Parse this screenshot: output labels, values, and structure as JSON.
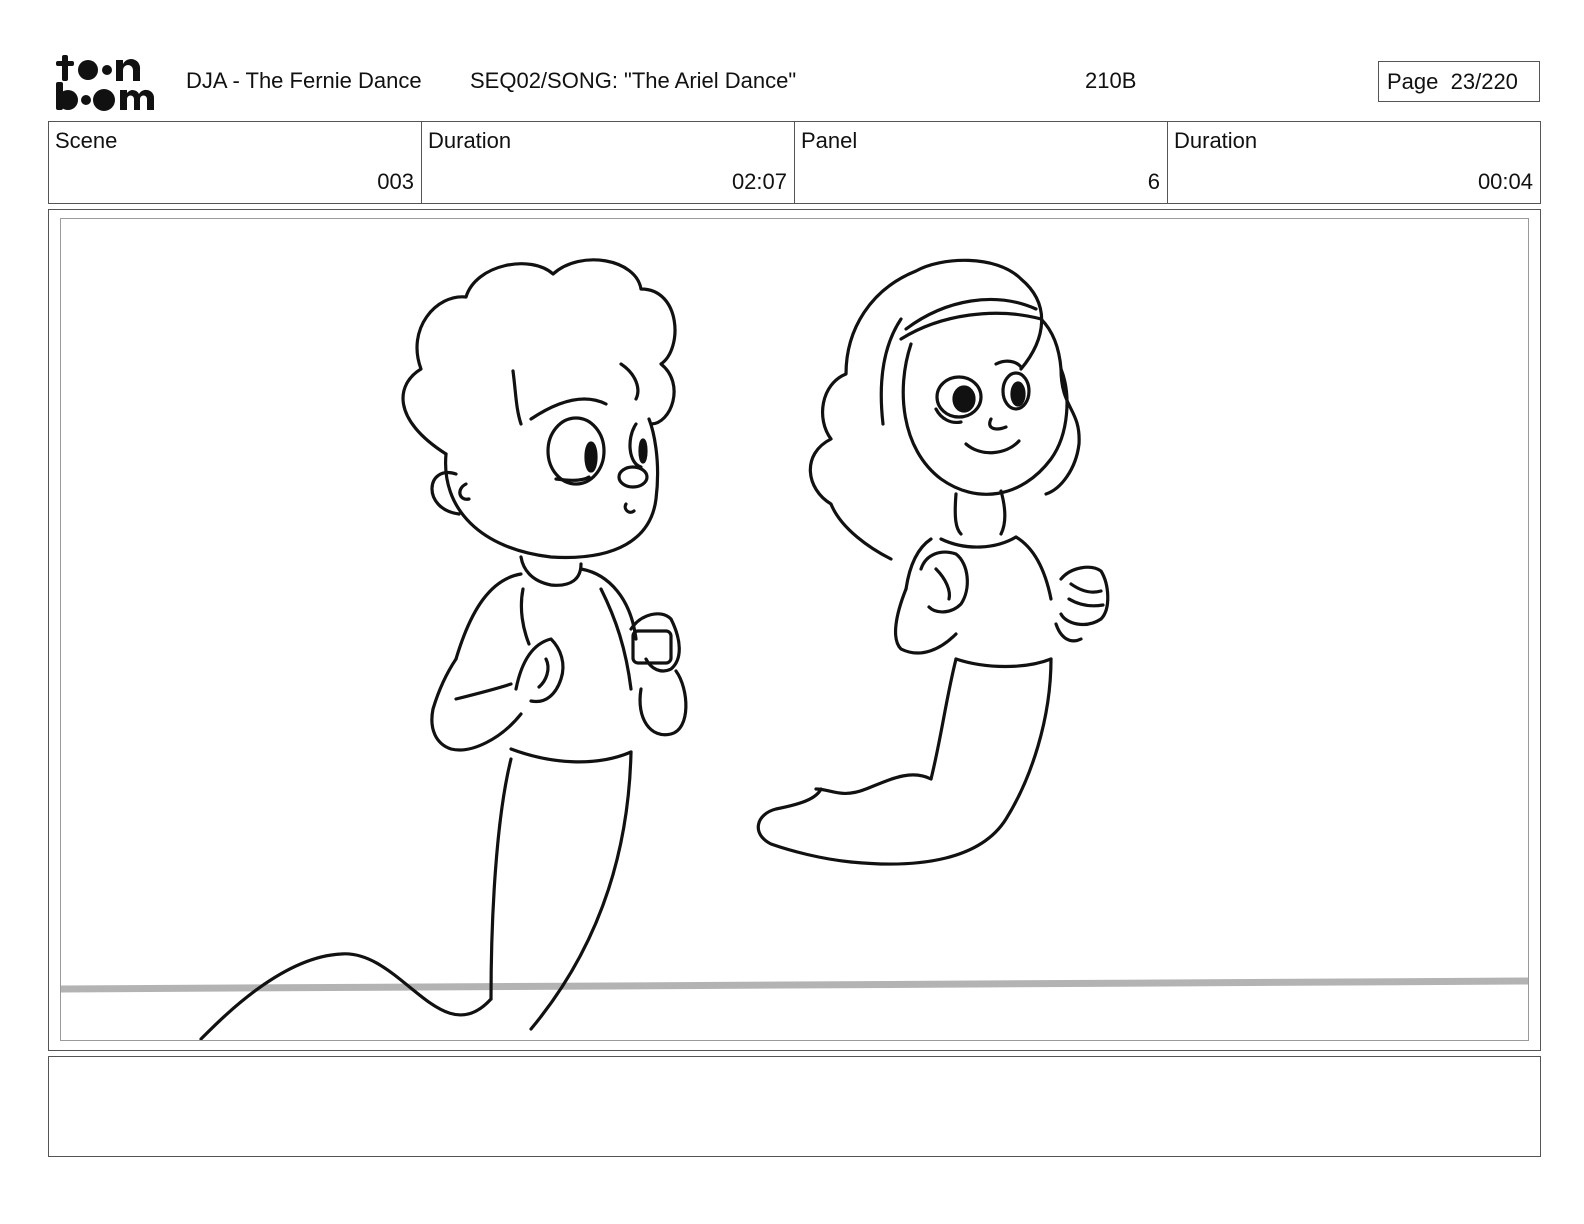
{
  "header": {
    "logo_text_top": "toon",
    "logo_text_bottom": "boom",
    "project_title": "DJA - The Fernie Dance",
    "sequence": "SEQ02/SONG: \"The Ariel Dance\"",
    "shot_code": "210B",
    "page_label": "Page",
    "page_value": "23/220"
  },
  "info": {
    "scene_label": "Scene",
    "scene_value": "003",
    "scene_duration_label": "Duration",
    "scene_duration_value": "02:07",
    "panel_label": "Panel",
    "panel_value": "6",
    "panel_duration_label": "Duration",
    "panel_duration_value": "00:04"
  },
  "notes": {
    "text": ""
  },
  "colors": {
    "ink": "#111111",
    "frame": "#9a9a9a",
    "horizon": "#b3b3b3"
  }
}
